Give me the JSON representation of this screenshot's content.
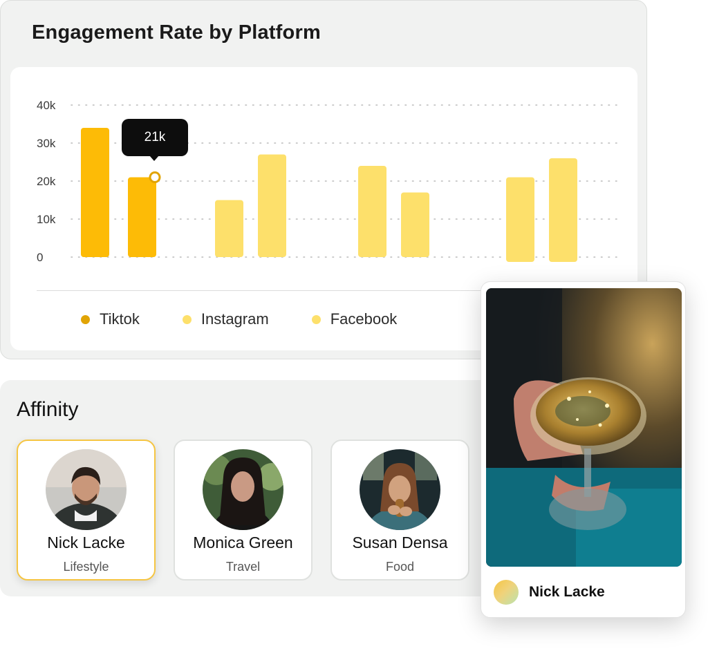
{
  "engagement": {
    "title": "Engagement Rate by Platform",
    "tooltip": "21k",
    "colors": {
      "tiktok": "#fdbb06",
      "instagram": "#fde06b",
      "facebook": "#fde06b",
      "tiktok_legend": "#e1a405"
    },
    "legend": [
      "Tiktok",
      "Instagram",
      "Facebook"
    ]
  },
  "chart_data": {
    "type": "bar",
    "y_ticks": [
      "40k",
      "30k",
      "20k",
      "10k",
      "0"
    ],
    "ylim": [
      0,
      40
    ],
    "grid": true,
    "legend_position": "bottom",
    "series": [
      {
        "name": "Tiktok",
        "values": [
          34,
          21
        ]
      },
      {
        "name": "Instagram",
        "values": [
          15,
          27
        ]
      },
      {
        "name": "Facebook",
        "values": [
          24,
          17
        ]
      },
      {
        "name": "",
        "values": [
          21,
          26
        ]
      }
    ]
  },
  "affinity": {
    "title": "Affinity",
    "cards": [
      {
        "name": "Nick Lacke",
        "category": "Lifestyle",
        "selected": true
      },
      {
        "name": "Monica Green",
        "category": "Travel",
        "selected": false
      },
      {
        "name": "Susan Densa",
        "category": "Food",
        "selected": false
      }
    ]
  },
  "post": {
    "author": "Nick Lacke"
  }
}
